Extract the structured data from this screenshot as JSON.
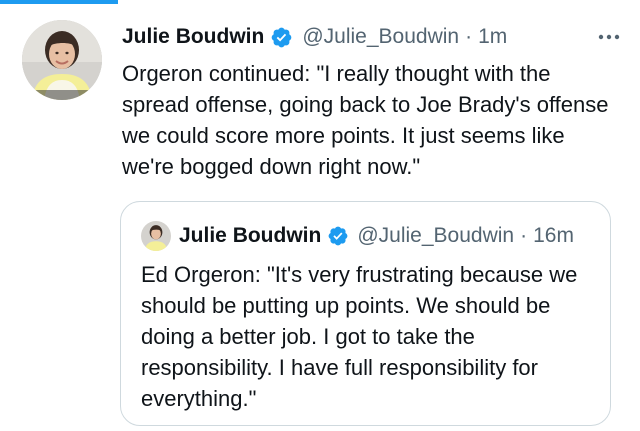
{
  "colors": {
    "accent": "#1d9bf0",
    "text": "#0f1419",
    "secondary": "#536471",
    "border": "#cfd9de"
  },
  "tweet": {
    "author_name": "Julie Boudwin",
    "handle": "@Julie_Boudwin",
    "separator": "·",
    "time": "1m",
    "verified_icon": "verified-badge-icon",
    "more_icon": "more-options-icon",
    "text": "Orgeron continued: \"I really thought with the spread offense, going back to Joe Brady's offense we could score more points. It just seems like we're bogged down right now.\""
  },
  "quoted_tweet": {
    "author_name": "Julie Boudwin",
    "handle": "@Julie_Boudwin",
    "separator": "·",
    "time": "16m",
    "verified_icon": "verified-badge-icon",
    "text": "Ed Orgeron: \"It's very frustrating because we should be putting up points. We should be doing a better job. I got to take the responsibility. I have full responsibility for everything.\""
  }
}
